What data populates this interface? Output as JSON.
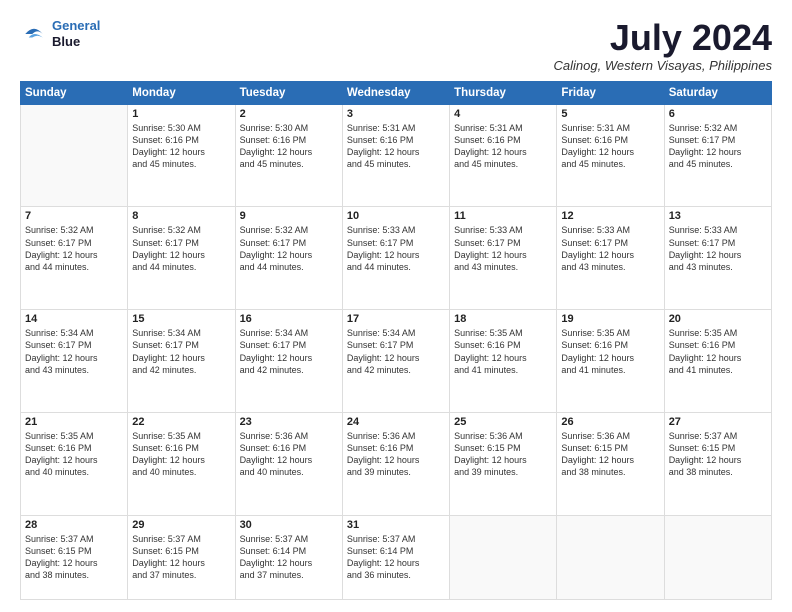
{
  "logo": {
    "line1": "General",
    "line2": "Blue"
  },
  "title": "July 2024",
  "subtitle": "Calinog, Western Visayas, Philippines",
  "weekdays": [
    "Sunday",
    "Monday",
    "Tuesday",
    "Wednesday",
    "Thursday",
    "Friday",
    "Saturday"
  ],
  "weeks": [
    [
      {
        "day": "",
        "info": ""
      },
      {
        "day": "1",
        "info": "Sunrise: 5:30 AM\nSunset: 6:16 PM\nDaylight: 12 hours\nand 45 minutes."
      },
      {
        "day": "2",
        "info": "Sunrise: 5:30 AM\nSunset: 6:16 PM\nDaylight: 12 hours\nand 45 minutes."
      },
      {
        "day": "3",
        "info": "Sunrise: 5:31 AM\nSunset: 6:16 PM\nDaylight: 12 hours\nand 45 minutes."
      },
      {
        "day": "4",
        "info": "Sunrise: 5:31 AM\nSunset: 6:16 PM\nDaylight: 12 hours\nand 45 minutes."
      },
      {
        "day": "5",
        "info": "Sunrise: 5:31 AM\nSunset: 6:16 PM\nDaylight: 12 hours\nand 45 minutes."
      },
      {
        "day": "6",
        "info": "Sunrise: 5:32 AM\nSunset: 6:17 PM\nDaylight: 12 hours\nand 45 minutes."
      }
    ],
    [
      {
        "day": "7",
        "info": "Sunrise: 5:32 AM\nSunset: 6:17 PM\nDaylight: 12 hours\nand 44 minutes."
      },
      {
        "day": "8",
        "info": "Sunrise: 5:32 AM\nSunset: 6:17 PM\nDaylight: 12 hours\nand 44 minutes."
      },
      {
        "day": "9",
        "info": "Sunrise: 5:32 AM\nSunset: 6:17 PM\nDaylight: 12 hours\nand 44 minutes."
      },
      {
        "day": "10",
        "info": "Sunrise: 5:33 AM\nSunset: 6:17 PM\nDaylight: 12 hours\nand 44 minutes."
      },
      {
        "day": "11",
        "info": "Sunrise: 5:33 AM\nSunset: 6:17 PM\nDaylight: 12 hours\nand 43 minutes."
      },
      {
        "day": "12",
        "info": "Sunrise: 5:33 AM\nSunset: 6:17 PM\nDaylight: 12 hours\nand 43 minutes."
      },
      {
        "day": "13",
        "info": "Sunrise: 5:33 AM\nSunset: 6:17 PM\nDaylight: 12 hours\nand 43 minutes."
      }
    ],
    [
      {
        "day": "14",
        "info": "Sunrise: 5:34 AM\nSunset: 6:17 PM\nDaylight: 12 hours\nand 43 minutes."
      },
      {
        "day": "15",
        "info": "Sunrise: 5:34 AM\nSunset: 6:17 PM\nDaylight: 12 hours\nand 42 minutes."
      },
      {
        "day": "16",
        "info": "Sunrise: 5:34 AM\nSunset: 6:17 PM\nDaylight: 12 hours\nand 42 minutes."
      },
      {
        "day": "17",
        "info": "Sunrise: 5:34 AM\nSunset: 6:17 PM\nDaylight: 12 hours\nand 42 minutes."
      },
      {
        "day": "18",
        "info": "Sunrise: 5:35 AM\nSunset: 6:16 PM\nDaylight: 12 hours\nand 41 minutes."
      },
      {
        "day": "19",
        "info": "Sunrise: 5:35 AM\nSunset: 6:16 PM\nDaylight: 12 hours\nand 41 minutes."
      },
      {
        "day": "20",
        "info": "Sunrise: 5:35 AM\nSunset: 6:16 PM\nDaylight: 12 hours\nand 41 minutes."
      }
    ],
    [
      {
        "day": "21",
        "info": "Sunrise: 5:35 AM\nSunset: 6:16 PM\nDaylight: 12 hours\nand 40 minutes."
      },
      {
        "day": "22",
        "info": "Sunrise: 5:35 AM\nSunset: 6:16 PM\nDaylight: 12 hours\nand 40 minutes."
      },
      {
        "day": "23",
        "info": "Sunrise: 5:36 AM\nSunset: 6:16 PM\nDaylight: 12 hours\nand 40 minutes."
      },
      {
        "day": "24",
        "info": "Sunrise: 5:36 AM\nSunset: 6:16 PM\nDaylight: 12 hours\nand 39 minutes."
      },
      {
        "day": "25",
        "info": "Sunrise: 5:36 AM\nSunset: 6:15 PM\nDaylight: 12 hours\nand 39 minutes."
      },
      {
        "day": "26",
        "info": "Sunrise: 5:36 AM\nSunset: 6:15 PM\nDaylight: 12 hours\nand 38 minutes."
      },
      {
        "day": "27",
        "info": "Sunrise: 5:37 AM\nSunset: 6:15 PM\nDaylight: 12 hours\nand 38 minutes."
      }
    ],
    [
      {
        "day": "28",
        "info": "Sunrise: 5:37 AM\nSunset: 6:15 PM\nDaylight: 12 hours\nand 38 minutes."
      },
      {
        "day": "29",
        "info": "Sunrise: 5:37 AM\nSunset: 6:15 PM\nDaylight: 12 hours\nand 37 minutes."
      },
      {
        "day": "30",
        "info": "Sunrise: 5:37 AM\nSunset: 6:14 PM\nDaylight: 12 hours\nand 37 minutes."
      },
      {
        "day": "31",
        "info": "Sunrise: 5:37 AM\nSunset: 6:14 PM\nDaylight: 12 hours\nand 36 minutes."
      },
      {
        "day": "",
        "info": ""
      },
      {
        "day": "",
        "info": ""
      },
      {
        "day": "",
        "info": ""
      }
    ]
  ]
}
